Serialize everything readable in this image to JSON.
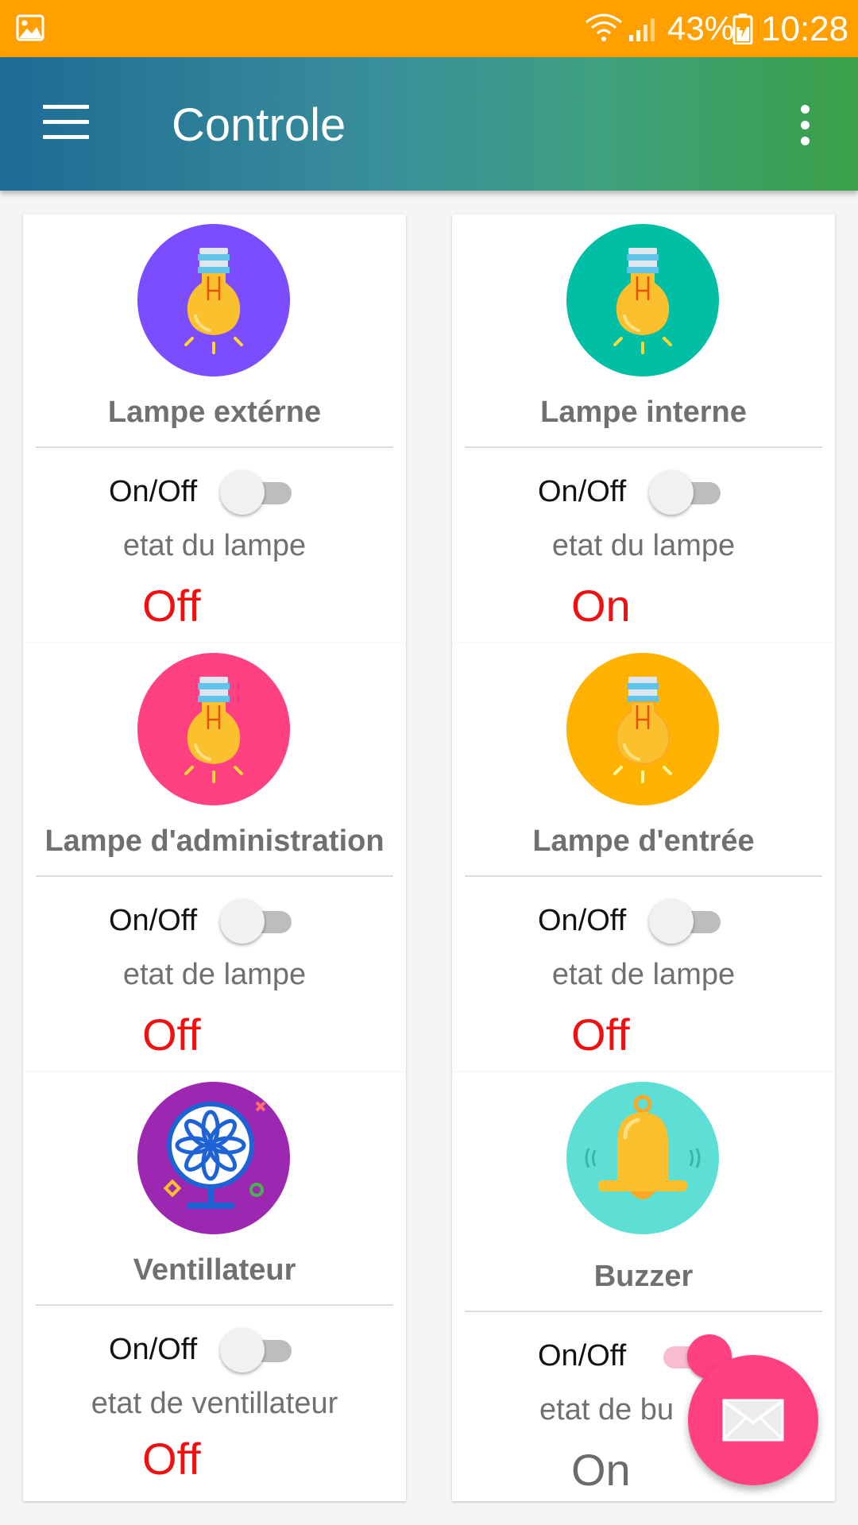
{
  "status_bar": {
    "battery": "43%",
    "time": "10:28"
  },
  "app_bar": {
    "title": "Controle"
  },
  "cards": [
    {
      "name": "Lampe extérne",
      "switch_label": "On/Off",
      "etat_label": "etat du lampe",
      "state": "Off",
      "icon": "lightbulb-icon",
      "circle_color": "#7c4dff",
      "switch_on": false
    },
    {
      "name": "Lampe interne",
      "switch_label": "On/Off",
      "etat_label": "etat du lampe",
      "state": "On",
      "icon": "lightbulb-icon",
      "circle_color": "#00bfa5",
      "switch_on": false
    },
    {
      "name": "Lampe d'administration",
      "switch_label": "On/Off",
      "etat_label": "etat de lampe",
      "state": "Off",
      "icon": "lightbulb-icon",
      "circle_color": "#ff4081",
      "switch_on": false
    },
    {
      "name": "Lampe d'entrée",
      "switch_label": "On/Off",
      "etat_label": "etat de lampe",
      "state": "Off",
      "icon": "lightbulb-icon",
      "circle_color": "#ffb300",
      "switch_on": false
    },
    {
      "name": "Ventillateur",
      "switch_label": "On/Off",
      "etat_label": "etat de ventillateur",
      "state": "Off",
      "icon": "fan-icon",
      "circle_color": "#9c27b0",
      "switch_on": false
    },
    {
      "name": "Buzzer",
      "switch_label": "On/Off",
      "etat_label": "etat de bu",
      "state": "On",
      "icon": "bell-icon",
      "circle_color": "#5ddfd5",
      "switch_on": true
    }
  ],
  "fab": {
    "icon": "mail-icon"
  }
}
